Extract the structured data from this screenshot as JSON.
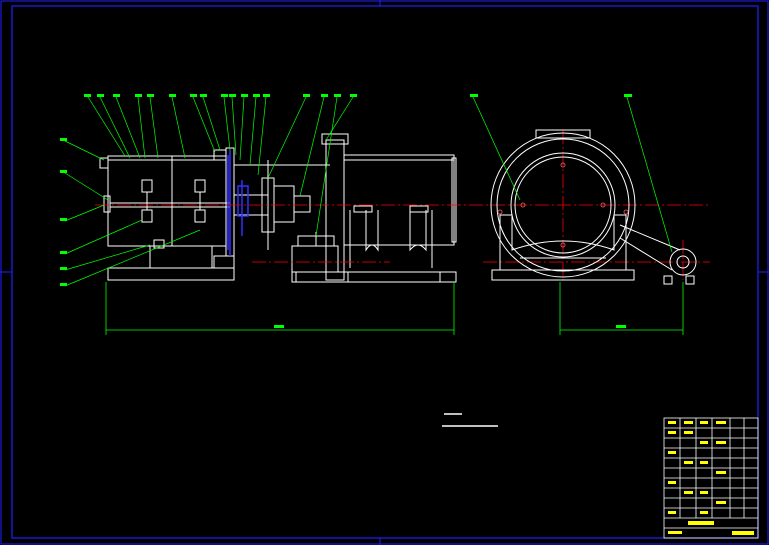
{
  "drawing": {
    "background": "#000000",
    "colors": {
      "border": "#2020ff",
      "geometry": "#ffffff",
      "leader": "#00ff00",
      "center": "#ff0000",
      "blue_part": "#3030ff",
      "titleblock": "#ffff00",
      "dim_line": "#00ff00"
    }
  },
  "left_view": {
    "dimension_label": "",
    "balloon_count_top": 19,
    "balloon_count_side": 7
  },
  "right_view": {
    "dimension_label": "",
    "balloon_count_top": 2
  },
  "title_block": {
    "rows": 12,
    "label": ""
  }
}
